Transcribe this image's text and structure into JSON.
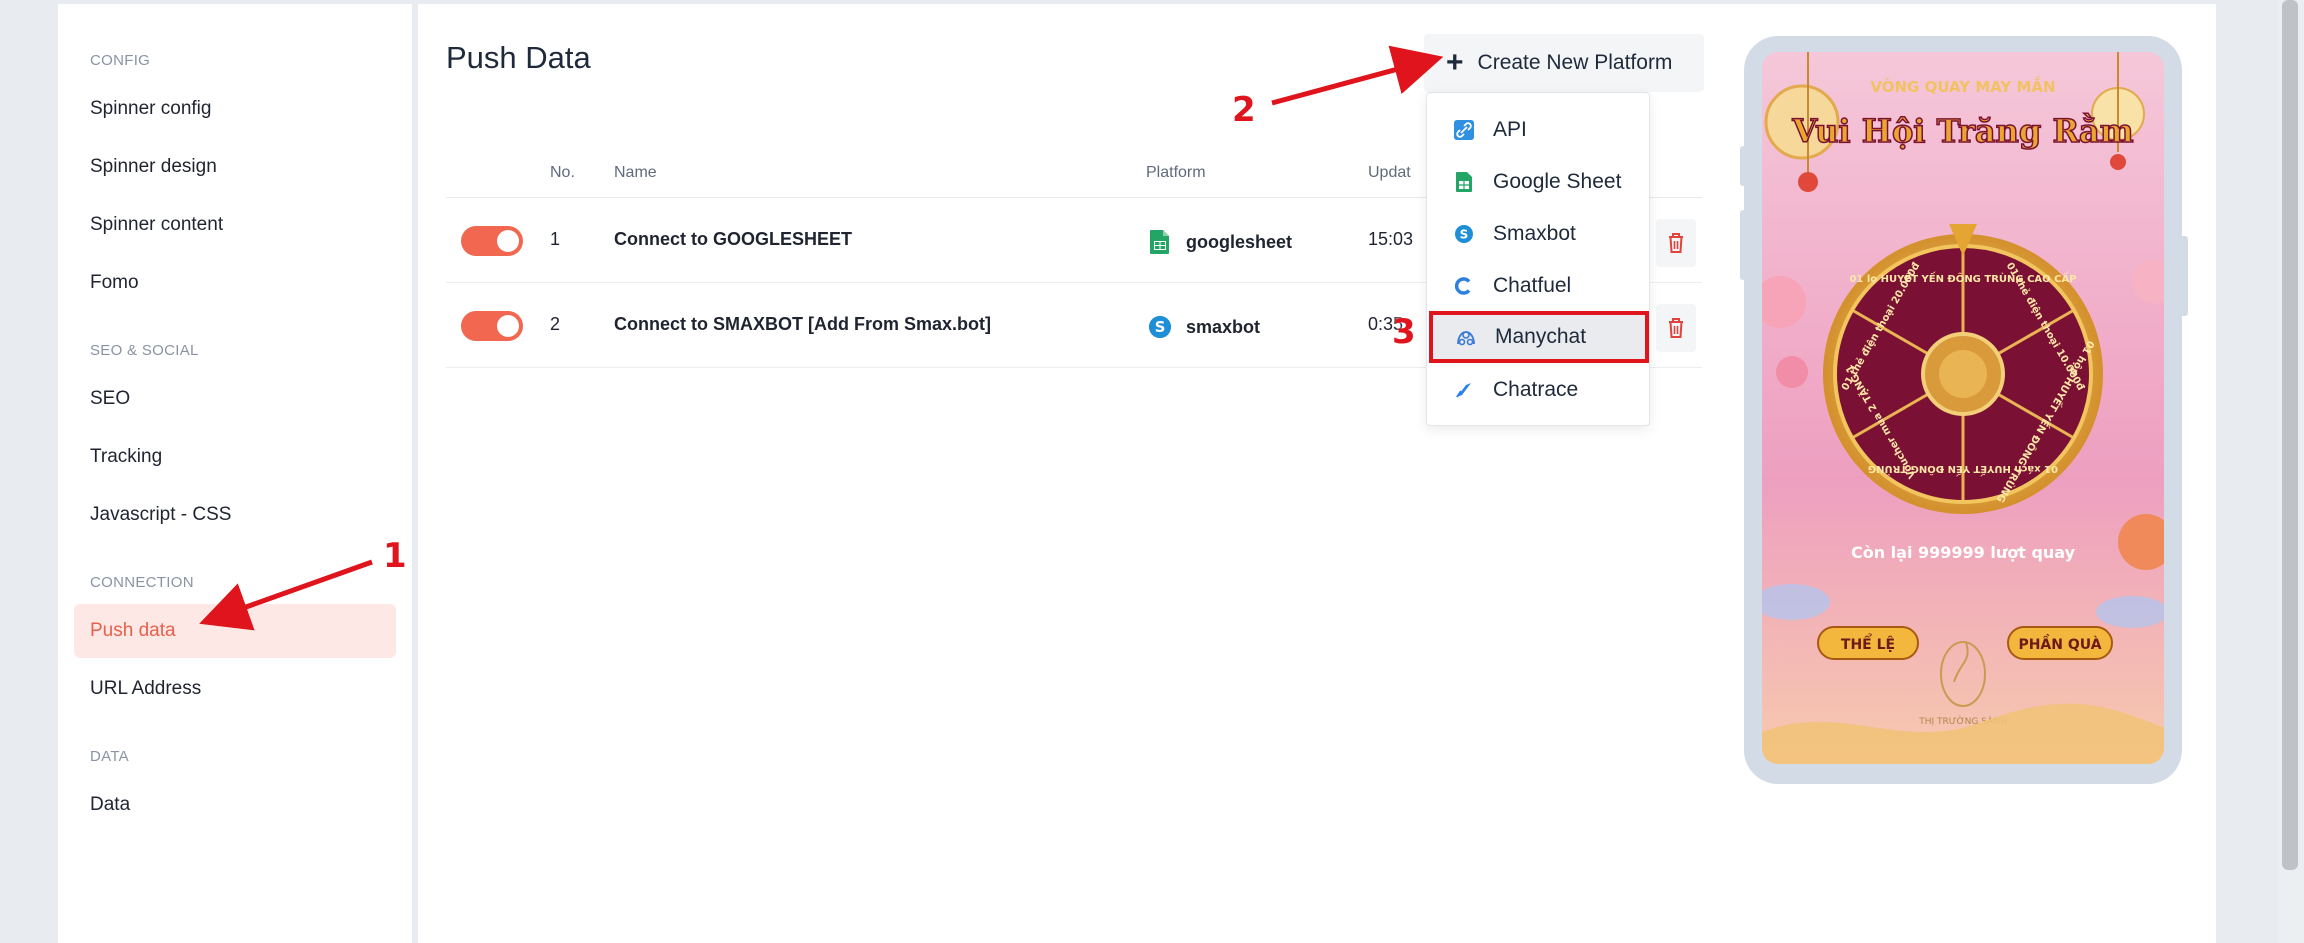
{
  "sidebar": {
    "sections": [
      {
        "title": "CONFIG",
        "items": [
          "Spinner config",
          "Spinner design",
          "Spinner content",
          "Fomo"
        ]
      },
      {
        "title": "SEO & SOCIAL",
        "items": [
          "SEO",
          "Tracking",
          "Javascript - CSS"
        ]
      },
      {
        "title": "CONNECTION",
        "items": [
          "Push data",
          "URL Address"
        ]
      },
      {
        "title": "DATA",
        "items": [
          "Data"
        ]
      }
    ],
    "active_item": "Push data"
  },
  "main": {
    "title": "Push Data",
    "create_button": {
      "icon": "plus-icon",
      "label": "Create New Platform"
    },
    "table": {
      "headers": [
        "No.",
        "Name",
        "Platform",
        "Updat"
      ],
      "rows": [
        {
          "enabled": true,
          "no": "1",
          "name": "Connect to GOOGLESHEET",
          "platform": "googlesheet",
          "platform_icon": "google-sheet-icon",
          "updated": "15:03"
        },
        {
          "enabled": true,
          "no": "2",
          "name": "Connect to SMAXBOT [Add From Smax.bot]",
          "platform": "smaxbot",
          "platform_icon": "smaxbot-icon",
          "updated": "0:35"
        }
      ]
    },
    "dropdown": {
      "items": [
        {
          "label": "API",
          "icon": "api-link-icon"
        },
        {
          "label": "Google Sheet",
          "icon": "google-sheet-icon"
        },
        {
          "label": "Smaxbot",
          "icon": "smaxbot-icon"
        },
        {
          "label": "Chatfuel",
          "icon": "chatfuel-icon"
        },
        {
          "label": "Manychat",
          "icon": "manychat-icon"
        },
        {
          "label": "Chatrace",
          "icon": "chatrace-icon"
        }
      ],
      "highlighted": "Manychat"
    }
  },
  "preview": {
    "header_small": "VÒNG QUAY MAY MẮN",
    "header_title": "Vui Hội Trăng Rằm",
    "spins_left": "Còn lại 999999 lượt quay",
    "rules_button": "THỂ LỆ",
    "prize_button": "PHẦN QUÀ",
    "brand": "THỊ TRƯỜNG SÀNH",
    "wheel_segments": [
      "01 lọ HUYẾT YẾN ĐÔNG TRÙNG CAO CẤP",
      "01 thẻ điện thoại 10.000đ",
      "01 hộp HUYẾT YẾN ĐÔNG TRÙNG",
      "01 xách HUYẾT YẾN ĐÔNG TRÙNG",
      "Voucher mua 2 TẶNG 1",
      "01 thẻ điện thoại 20.000đ"
    ]
  },
  "annotations": [
    "1",
    "2",
    "3"
  ],
  "colors": {
    "accent": "#f2674f",
    "active_bg": "#fde8e6",
    "active_text": "#e8604c",
    "annotation": "#e0141c",
    "sheet_green": "#23a566",
    "smax_blue": "#1e8fd6"
  }
}
